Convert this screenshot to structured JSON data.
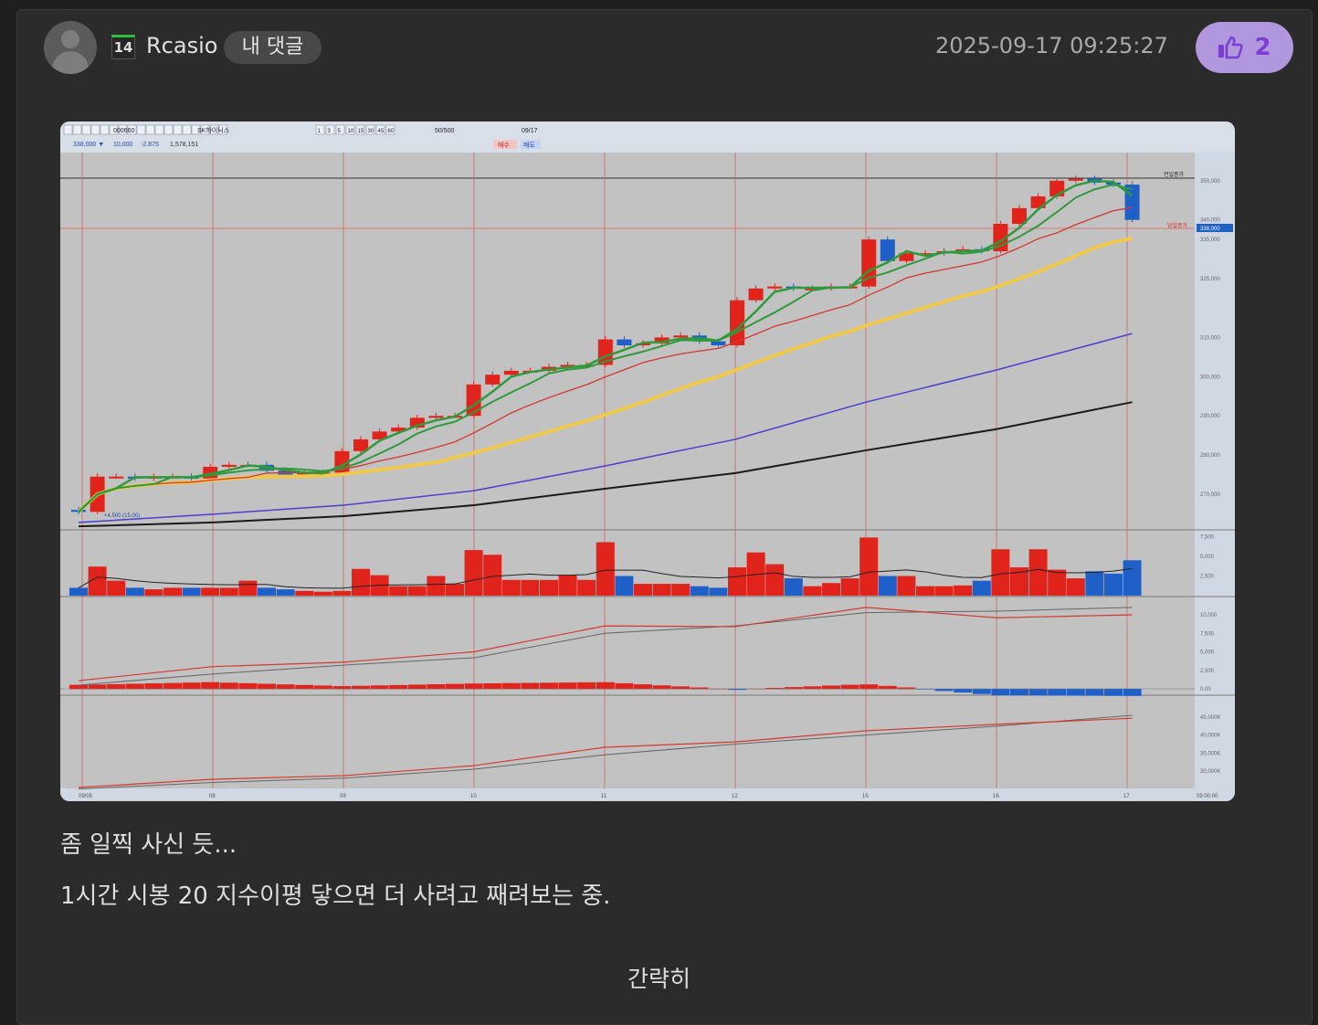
{
  "comment": {
    "author": "Rcasio",
    "level": "14",
    "tag": "내 댓글",
    "timestamp": "2025-09-17 09:25:27",
    "like_count": "2",
    "lines": [
      "좀 일찍 사신 듯...",
      "1시간 시봉 20 지수이평 닿으면 더 사려고 째려보는 중."
    ],
    "collapse_label": "간략히"
  },
  "colors": {
    "up": "#e0241c",
    "down": "#1f5fc8",
    "ma_short": "#2f9a3c",
    "ma_mid": "#d33a2f",
    "ma_20": "#f0c84a",
    "ma_long": "#4a3fd0",
    "ma_longest": "#1a1a1a",
    "like_bg": "#b197dd",
    "like_fg": "#7a3fd2"
  },
  "toolbar": {
    "code": "000660",
    "name": "SK하이닉스",
    "intervals": [
      "1",
      "3",
      "5",
      "10",
      "15",
      "30",
      "45",
      "60"
    ],
    "count": "50/500",
    "date": "09/17",
    "price": "338,000 ▼",
    "change": "10,000",
    "rate": "-2.875",
    "volume": "1,578,151",
    "buy": "매수",
    "sell": "매도"
  },
  "chart_data": {
    "type": "candlestick",
    "title": "SK하이닉스 60분봉",
    "x_ticks": [
      "09/05",
      "08",
      "09",
      "10",
      "11",
      "12",
      "15",
      "16",
      "17"
    ],
    "x_end_label": "09:00:00",
    "price_ticks": [
      "350,000",
      "340,000",
      "335,000",
      "325,000",
      "310,000",
      "300,000",
      "290,000",
      "280,000",
      "270,000"
    ],
    "price_tick_values": [
      350,
      340,
      335,
      325,
      310,
      300,
      290,
      280,
      270
    ],
    "price_unit": "thousand KRW",
    "current_price_label": "338,000",
    "annotations": {
      "prev_close": "전일종가",
      "today_close": "당일종가",
      "low_label": "+4,500 (15.00)"
    },
    "closes": [
      265.5,
      274.5,
      274.5,
      274,
      274.5,
      274.5,
      274,
      277,
      277.5,
      277.5,
      276,
      275,
      275.5,
      275.5,
      281,
      284,
      286,
      287,
      289.5,
      290,
      290,
      298,
      300.5,
      301.5,
      301.5,
      302.5,
      303,
      303,
      309.5,
      308,
      308.5,
      310,
      310.5,
      309,
      308,
      319.5,
      322.5,
      323,
      322.5,
      322.5,
      323,
      323,
      335,
      329.5,
      331.5,
      331.5,
      332,
      332.5,
      332,
      339,
      343,
      346,
      350,
      350.5,
      349.5,
      349,
      340
    ],
    "ma_long_by_day": [
      262.8,
      264.9,
      267.2,
      270.9,
      277.2,
      284,
      293.5,
      301.7,
      311
    ],
    "ma_longest_by_day": [
      261.8,
      262.8,
      264.4,
      267.2,
      271.4,
      275.4,
      281.2,
      286.6,
      293.5
    ],
    "volume_ticks": [
      "7,500",
      "5,000",
      "2,500"
    ],
    "volume_tick_values": [
      7500,
      5000,
      2500
    ],
    "volume": [
      1000,
      3700,
      1900,
      1000,
      800,
      1000,
      1000,
      1000,
      1000,
      1900,
      1000,
      800,
      600,
      500,
      600,
      3400,
      2600,
      1200,
      1200,
      2500,
      1500,
      5800,
      5200,
      2000,
      2000,
      2000,
      2600,
      2000,
      6800,
      2500,
      1500,
      1500,
      1500,
      1200,
      1000,
      3600,
      5500,
      4000,
      2200,
      1200,
      1600,
      2200,
      7400,
      2500,
      2500,
      1200,
      1200,
      1300,
      1900,
      5900,
      3600,
      5900,
      3300,
      2200,
      3100,
      2800,
      4500
    ],
    "macd_ticks": [
      "10,000",
      "7,500",
      "5,000",
      "2,500",
      "0.00"
    ],
    "macd_tick_values": [
      10000,
      7500,
      5000,
      2500,
      0
    ],
    "macd_by_day": [
      1100,
      3000,
      3600,
      5000,
      8500,
      8400,
      11000,
      9600,
      10000
    ],
    "signal_by_day": [
      500,
      2000,
      3200,
      4200,
      7500,
      8500,
      10300,
      10500,
      11000
    ],
    "obv_ticks": [
      "45,000K",
      "40,000K",
      "35,000K",
      "30,000K"
    ],
    "obv_tick_values": [
      45000,
      40000,
      35000,
      30000
    ],
    "obv_by_day": [
      25400,
      27700,
      28700,
      31500,
      36600,
      38100,
      41200,
      43000,
      44700
    ],
    "obv_signal_by_day": [
      25000,
      26800,
      28000,
      30500,
      34500,
      37500,
      40000,
      42500,
      45500
    ]
  }
}
